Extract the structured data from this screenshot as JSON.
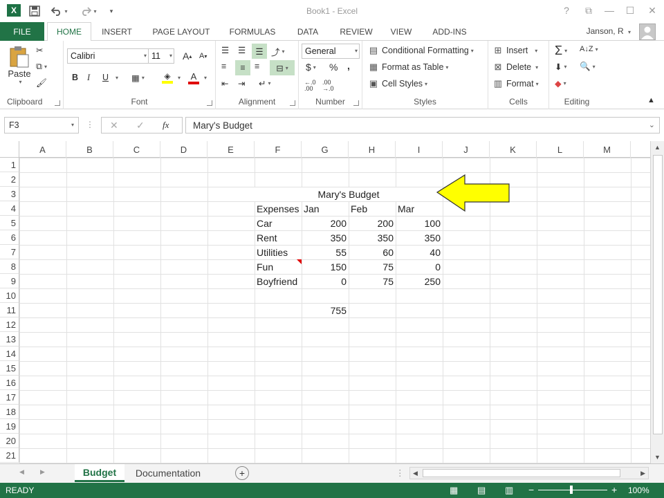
{
  "window": {
    "title": "Book1 - Excel"
  },
  "qat": {
    "logo": "X",
    "save_icon": "save-icon",
    "undo_icon": "undo-icon",
    "redo_icon": "redo-icon"
  },
  "window_buttons": {
    "help": "?",
    "restore_ribbon": "⧉",
    "minimize": "—",
    "maximize": "☐",
    "close": "✕"
  },
  "tabs": {
    "file": "FILE",
    "items": [
      "HOME",
      "INSERT",
      "PAGE LAYOUT",
      "FORMULAS",
      "DATA",
      "REVIEW",
      "VIEW",
      "ADD-INS"
    ],
    "active": "HOME"
  },
  "user": {
    "name": "Janson, R"
  },
  "ribbon": {
    "clipboard": {
      "label": "Clipboard",
      "paste": "Paste"
    },
    "font": {
      "label": "Font",
      "family": "Calibri",
      "size": "11",
      "bold": "B",
      "italic": "I",
      "underline": "U"
    },
    "alignment": {
      "label": "Alignment"
    },
    "number": {
      "label": "Number",
      "format": "General",
      "currency": "$",
      "percent": "%",
      "comma": ","
    },
    "styles": {
      "label": "Styles",
      "conditional": "Conditional Formatting",
      "table": "Format as Table",
      "cell": "Cell Styles"
    },
    "cells": {
      "label": "Cells",
      "insert": "Insert",
      "delete": "Delete",
      "format": "Format"
    },
    "editing": {
      "label": "Editing"
    }
  },
  "formula_bar": {
    "name_box": "F3",
    "cancel": "✕",
    "enter": "✓",
    "fx": "fx",
    "formula": "Mary's Budget"
  },
  "grid": {
    "columns": [
      "A",
      "B",
      "C",
      "D",
      "E",
      "F",
      "G",
      "H",
      "I",
      "J",
      "K",
      "L",
      "M"
    ],
    "rows": [
      "1",
      "2",
      "3",
      "4",
      "5",
      "6",
      "7",
      "8",
      "9",
      "10",
      "11",
      "12",
      "13",
      "14",
      "15",
      "16",
      "17",
      "18",
      "19",
      "20",
      "21"
    ],
    "title": "Mary's Budget",
    "header": [
      "Expenses",
      "Jan",
      "Feb",
      "Mar"
    ],
    "data": [
      [
        "Car",
        "200",
        "200",
        "100"
      ],
      [
        "Rent",
        "350",
        "350",
        "350"
      ],
      [
        "Utilities",
        "55",
        "60",
        "40"
      ],
      [
        "Fun",
        "150",
        "75",
        "0"
      ],
      [
        "Boyfriend",
        "0",
        "75",
        "250"
      ]
    ],
    "total": "755"
  },
  "sheets": {
    "items": [
      "Budget",
      "Documentation"
    ],
    "active": "Budget",
    "add": "+"
  },
  "status": {
    "text": "READY",
    "zoom": "100%"
  },
  "colors": {
    "accent": "#217346",
    "arrow": "#ffff00",
    "comment_marker": "#e00000"
  }
}
